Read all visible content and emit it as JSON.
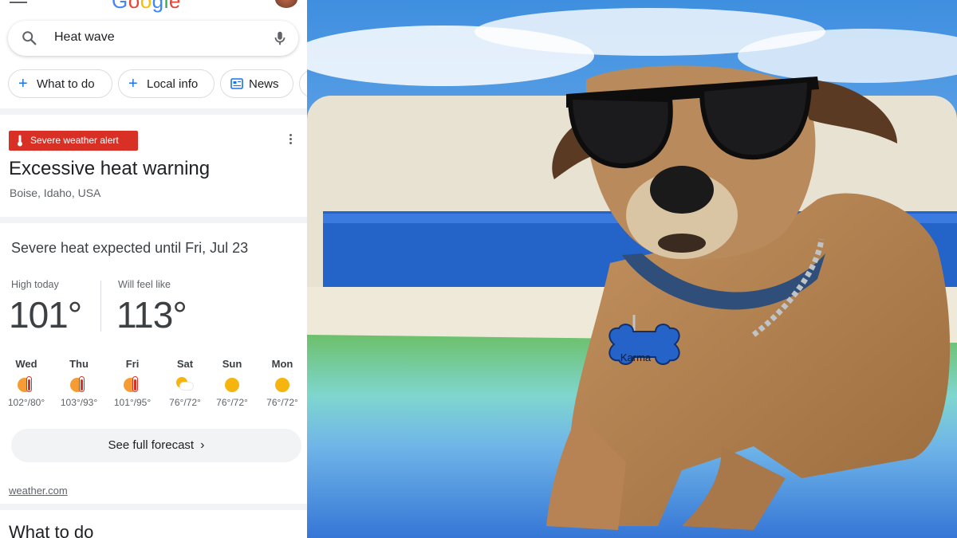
{
  "header": {
    "logo": "Google",
    "search_value": "Heat wave",
    "chips": [
      "What to do",
      "Local info",
      "News"
    ]
  },
  "alert": {
    "badge": "Severe weather alert",
    "title": "Excessive heat warning",
    "location": "Boise, Idaho, USA"
  },
  "weather": {
    "headline": "Severe heat expected until Fri, Jul 23",
    "high_label": "High today",
    "high_value": "101°",
    "feel_label": "Will feel like",
    "feel_value": "113°",
    "days": [
      {
        "day": "Wed",
        "temps": "102°/80°",
        "icon": "hot-icon"
      },
      {
        "day": "Thu",
        "temps": "103°/93°",
        "icon": "hot-icon"
      },
      {
        "day": "Fri",
        "temps": "101°/95°",
        "icon": "hot-icon"
      },
      {
        "day": "Sat",
        "temps": "76°/72°",
        "icon": "partly-sunny-icon"
      },
      {
        "day": "Sun",
        "temps": "76°/72°",
        "icon": "sunny-icon"
      },
      {
        "day": "Mon",
        "temps": "76°/72°",
        "icon": "sunny-icon"
      }
    ],
    "forecast_button": "See full forecast",
    "source": "weather.com"
  },
  "next_section": "What to do",
  "photo": {
    "tag_text": "Karma"
  },
  "colors": {
    "alert_red": "#d93025",
    "link_blue": "#1a73e8",
    "sun_yellow": "#f6b40e"
  }
}
